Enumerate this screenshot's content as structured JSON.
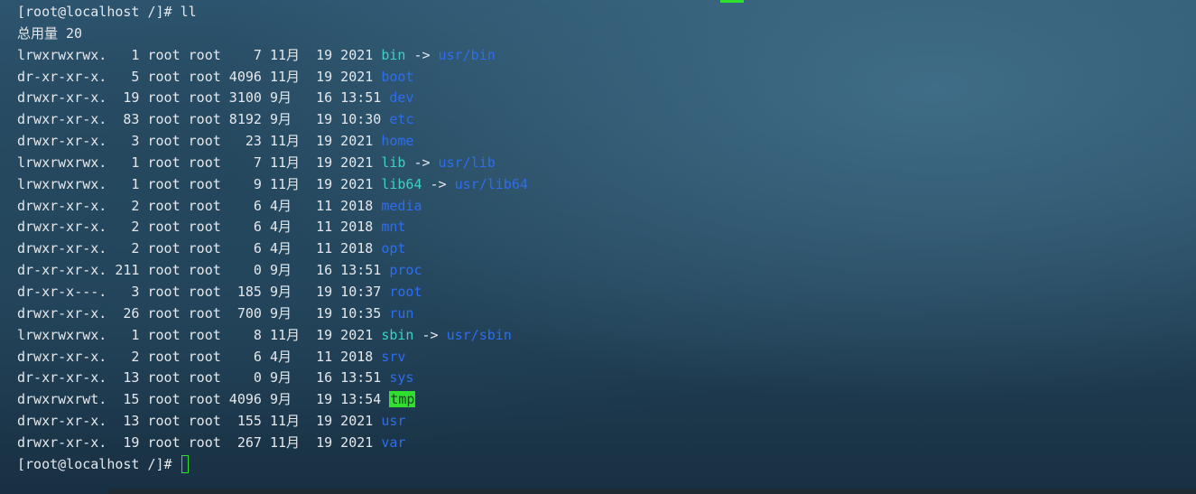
{
  "terminal": {
    "command_line": {
      "prompt": "[root@localhost /]#",
      "command": "ll"
    },
    "total_line": "总用量 20",
    "entries": [
      {
        "info": "lrwxrwxrwx.   1 root root    7 11月  19 2021",
        "name": "bin",
        "type": "link",
        "target": "usr/bin"
      },
      {
        "info": "dr-xr-xr-x.   5 root root 4096 11月  19 2021",
        "name": "boot",
        "type": "dir",
        "target": ""
      },
      {
        "info": "drwxr-xr-x.  19 root root 3100 9月   16 13:51",
        "name": "dev",
        "type": "dir",
        "target": ""
      },
      {
        "info": "drwxr-xr-x.  83 root root 8192 9月   19 10:30",
        "name": "etc",
        "type": "dir",
        "target": ""
      },
      {
        "info": "drwxr-xr-x.   3 root root   23 11月  19 2021",
        "name": "home",
        "type": "dir",
        "target": ""
      },
      {
        "info": "lrwxrwxrwx.   1 root root    7 11月  19 2021",
        "name": "lib",
        "type": "link",
        "target": "usr/lib"
      },
      {
        "info": "lrwxrwxrwx.   1 root root    9 11月  19 2021",
        "name": "lib64",
        "type": "link",
        "target": "usr/lib64"
      },
      {
        "info": "drwxr-xr-x.   2 root root    6 4月   11 2018",
        "name": "media",
        "type": "dir",
        "target": ""
      },
      {
        "info": "drwxr-xr-x.   2 root root    6 4月   11 2018",
        "name": "mnt",
        "type": "dir",
        "target": ""
      },
      {
        "info": "drwxr-xr-x.   2 root root    6 4月   11 2018",
        "name": "opt",
        "type": "dir",
        "target": ""
      },
      {
        "info": "dr-xr-xr-x. 211 root root    0 9月   16 13:51",
        "name": "proc",
        "type": "dir",
        "target": ""
      },
      {
        "info": "dr-xr-x---.   3 root root  185 9月   19 10:37",
        "name": "root",
        "type": "dir",
        "target": ""
      },
      {
        "info": "drwxr-xr-x.  26 root root  700 9月   19 10:35",
        "name": "run",
        "type": "dir",
        "target": ""
      },
      {
        "info": "lrwxrwxrwx.   1 root root    8 11月  19 2021",
        "name": "sbin",
        "type": "link",
        "target": "usr/sbin"
      },
      {
        "info": "drwxr-xr-x.   2 root root    6 4月   11 2018",
        "name": "srv",
        "type": "dir",
        "target": ""
      },
      {
        "info": "dr-xr-xr-x.  13 root root    0 9月   16 13:51",
        "name": "sys",
        "type": "dir",
        "target": ""
      },
      {
        "info": "drwxrwxrwt.  15 root root 4096 9月   19 13:54",
        "name": "tmp",
        "type": "sticky",
        "target": ""
      },
      {
        "info": "drwxr-xr-x.  13 root root  155 11月  19 2021",
        "name": "usr",
        "type": "dir",
        "target": ""
      },
      {
        "info": "drwxr-xr-x.  19 root root  267 11月  19 2021",
        "name": "var",
        "type": "dir",
        "target": ""
      }
    ],
    "final_prompt": "[root@localhost /]#",
    "link_arrow": "->"
  },
  "colors": {
    "text": "#e4e8ec",
    "link": "#3fd1c6",
    "directory": "#2e6df0",
    "sticky_bg": "#2fe02f",
    "cursor": "#2fe02f"
  }
}
